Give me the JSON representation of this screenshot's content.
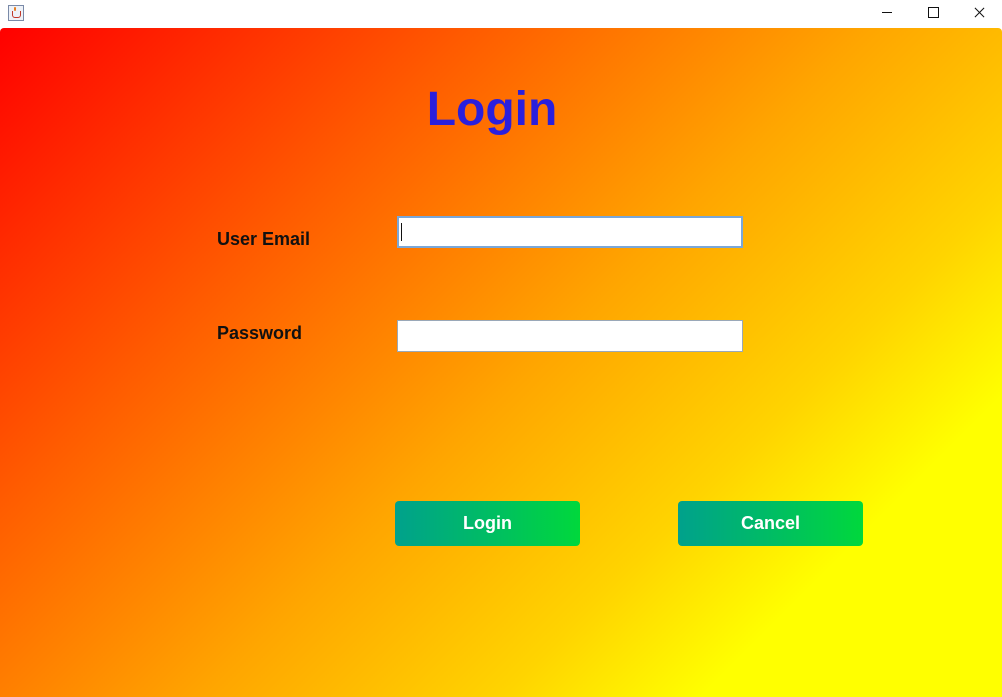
{
  "window": {
    "icon": "java-cup-icon",
    "controls": [
      "minimize-icon",
      "maximize-icon",
      "close-icon"
    ]
  },
  "form": {
    "title": "Login",
    "email": {
      "label": "User Email",
      "value": "",
      "placeholder": ""
    },
    "password": {
      "label": "Password",
      "value": "",
      "placeholder": ""
    },
    "login_button": "Login",
    "cancel_button": "Cancel"
  },
  "colors": {
    "title": "#2a1fdc",
    "background_start": "#ff0000",
    "background_end": "#ffff00",
    "button_start": "#00a18c",
    "button_end": "#00d83c"
  }
}
